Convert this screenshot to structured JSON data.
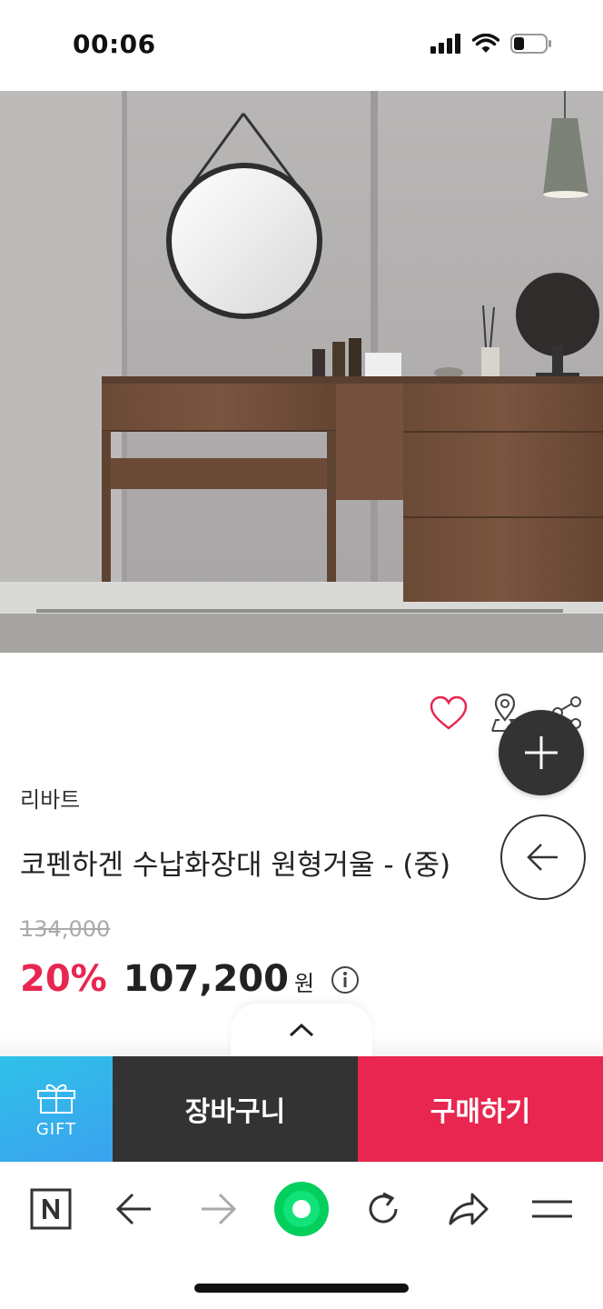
{
  "status_bar": {
    "time": "00:06"
  },
  "product": {
    "brand": "리바트",
    "title": "코펜하겐 수납화장대 원형거울 - (중)",
    "original_price": "134,000",
    "discount": "20%",
    "price": "107,200",
    "currency": "원"
  },
  "actions": {
    "gift_label": "GIFT",
    "cart_label": "장바구니",
    "buy_label": "구매하기"
  },
  "colors": {
    "accent": "#e8264f",
    "dark": "#333333",
    "gift_blue": "#2fc1e8",
    "naver_green": "#03cf5d"
  },
  "icons": [
    "heart-icon",
    "map-pin-icon",
    "share-icon",
    "plus-icon",
    "back-arrow-icon",
    "info-icon",
    "chevron-up-icon",
    "gift-icon",
    "naver-logo-icon",
    "back-icon",
    "forward-icon",
    "home-icon",
    "refresh-icon",
    "share-arrow-icon",
    "menu-icon"
  ]
}
